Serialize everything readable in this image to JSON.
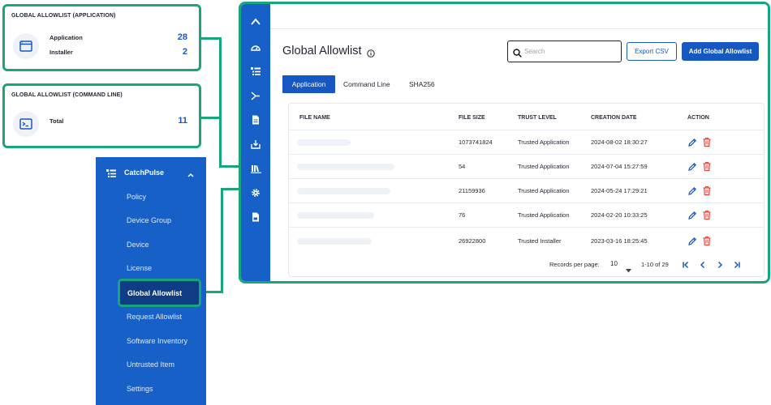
{
  "cards": {
    "application": {
      "title": "GLOBAL ALLOWLIST (APPLICATION)",
      "icon": "window-icon",
      "stats": [
        {
          "label": "Application",
          "value": "28"
        },
        {
          "label": "Installer",
          "value": "2"
        }
      ]
    },
    "command_line": {
      "title": "GLOBAL ALLOWLIST (COMMAND LINE)",
      "icon": "terminal-icon",
      "stats": [
        {
          "label": "Total",
          "value": "11"
        }
      ]
    }
  },
  "menu": {
    "header_label": "CatchPulse",
    "items": [
      {
        "label": "Policy"
      },
      {
        "label": "Device Group"
      },
      {
        "label": "Device"
      },
      {
        "label": "License"
      },
      {
        "label": "Global Allowlist",
        "active": true
      },
      {
        "label": "Request Allowlist"
      },
      {
        "label": "Software Inventory"
      },
      {
        "label": "Untrusted Item"
      },
      {
        "label": "Settings"
      }
    ]
  },
  "rail_icons": [
    "chevron-up-icon",
    "dashboard-icon",
    "list-icon",
    "branch-icon",
    "document-icon",
    "download-icon",
    "library-icon",
    "gear-icon",
    "report-icon"
  ],
  "main": {
    "title": "Global Allowlist",
    "search": {
      "placeholder": "Search",
      "value": ""
    },
    "export_label": "Export CSV",
    "add_label": "Add Global Allowlist",
    "tabs": [
      {
        "label": "Application",
        "active": true
      },
      {
        "label": "Command Line"
      },
      {
        "label": "SHA256"
      }
    ],
    "table": {
      "columns": [
        "FILE NAME",
        "FILE SIZE",
        "TRUST LEVEL",
        "CREATION DATE",
        "ACTION"
      ],
      "rows": [
        {
          "file_size": "1073741824",
          "trust_level": "Trusted Application",
          "creation_date": "2024-08-02 18:30:27"
        },
        {
          "file_size": "54",
          "trust_level": "Trusted Application",
          "creation_date": "2024-07-04 15:27:59"
        },
        {
          "file_size": "21159936",
          "trust_level": "Trusted Application",
          "creation_date": "2024-05-24 17:29:21"
        },
        {
          "file_size": "76",
          "trust_level": "Trusted Application",
          "creation_date": "2024-02-20 10:33:25"
        },
        {
          "file_size": "26922800",
          "trust_level": "Trusted Installer",
          "creation_date": "2023-03-16 18:25:45"
        }
      ]
    },
    "pagination": {
      "records_label": "Records per page:",
      "per_page": "10",
      "range": "1-10 of 29"
    }
  },
  "colors": {
    "accent_green": "#16a57c",
    "brand_blue": "#1657c1",
    "menu_blue": "#1660c7",
    "delete_red": "#e0453a"
  }
}
